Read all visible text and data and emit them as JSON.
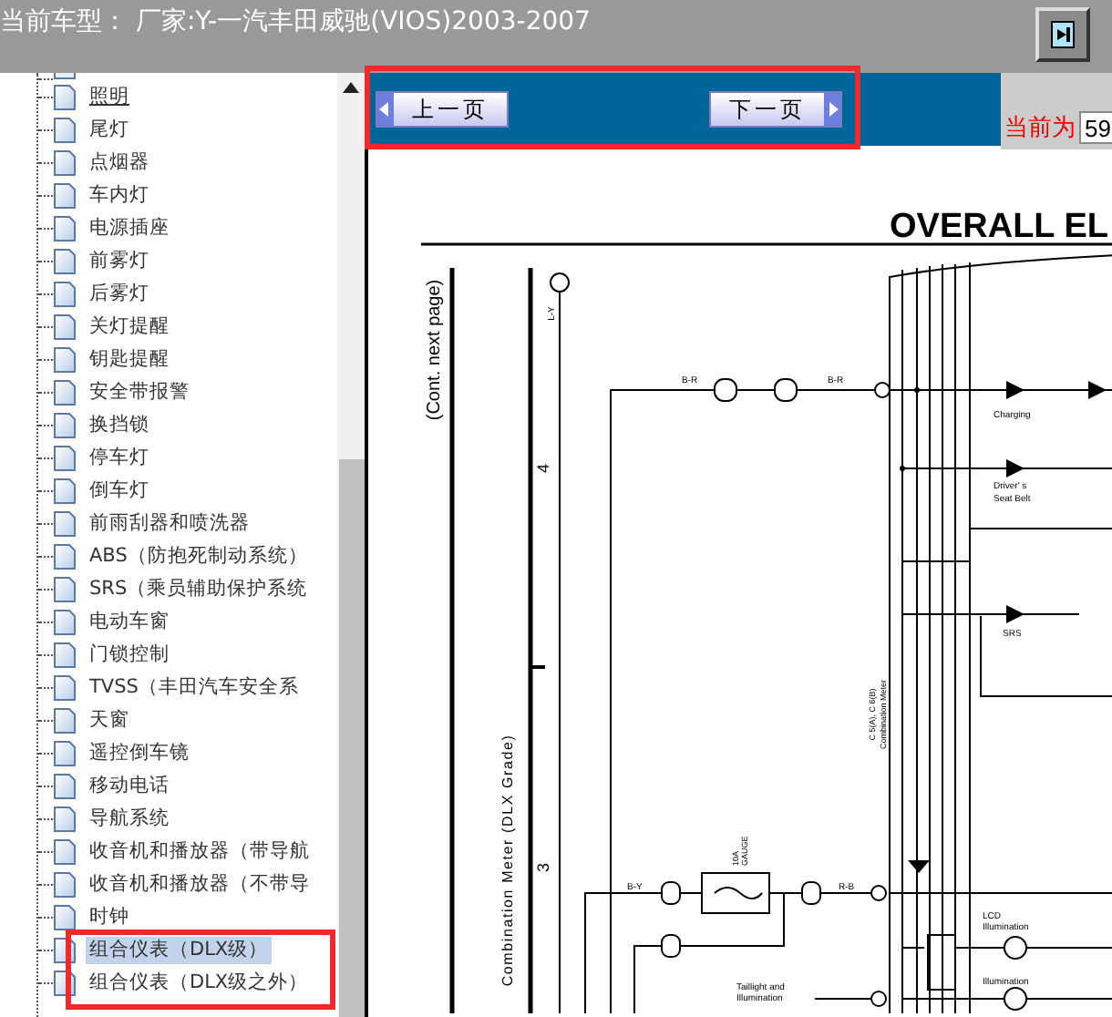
{
  "header": {
    "title": "当前车型： 厂家:Y-一汽丰田威驰(VIOS)2003-2007"
  },
  "tree": {
    "items": [
      {
        "label": "照明",
        "selected": false,
        "hovered": true
      },
      {
        "label": "尾灯",
        "selected": false,
        "hovered": false
      },
      {
        "label": "点烟器",
        "selected": false,
        "hovered": false
      },
      {
        "label": "车内灯",
        "selected": false,
        "hovered": false
      },
      {
        "label": "电源插座",
        "selected": false,
        "hovered": false
      },
      {
        "label": "前雾灯",
        "selected": false,
        "hovered": false
      },
      {
        "label": "后雾灯",
        "selected": false,
        "hovered": false
      },
      {
        "label": "关灯提醒",
        "selected": false,
        "hovered": false
      },
      {
        "label": "钥匙提醒",
        "selected": false,
        "hovered": false
      },
      {
        "label": "安全带报警",
        "selected": false,
        "hovered": false
      },
      {
        "label": "换挡锁",
        "selected": false,
        "hovered": false
      },
      {
        "label": "停车灯",
        "selected": false,
        "hovered": false
      },
      {
        "label": "倒车灯",
        "selected": false,
        "hovered": false
      },
      {
        "label": "前雨刮器和喷洗器",
        "selected": false,
        "hovered": false
      },
      {
        "label": "ABS（防抱死制动系统）",
        "selected": false,
        "hovered": false
      },
      {
        "label": "SRS（乘员辅助保护系统",
        "selected": false,
        "hovered": false
      },
      {
        "label": "电动车窗",
        "selected": false,
        "hovered": false
      },
      {
        "label": "门锁控制",
        "selected": false,
        "hovered": false
      },
      {
        "label": "TVSS（丰田汽车安全系",
        "selected": false,
        "hovered": false
      },
      {
        "label": "天窗",
        "selected": false,
        "hovered": false
      },
      {
        "label": "遥控倒车镜",
        "selected": false,
        "hovered": false
      },
      {
        "label": "移动电话",
        "selected": false,
        "hovered": false
      },
      {
        "label": "导航系统",
        "selected": false,
        "hovered": false
      },
      {
        "label": "收音机和播放器（带导航",
        "selected": false,
        "hovered": false
      },
      {
        "label": "收音机和播放器（不带导",
        "selected": false,
        "hovered": false
      },
      {
        "label": "时钟",
        "selected": false,
        "hovered": false
      },
      {
        "label": "组合仪表（DLX级）",
        "selected": true,
        "hovered": false
      },
      {
        "label": "组合仪表（DLX级之外）",
        "selected": false,
        "hovered": false
      }
    ]
  },
  "toolbar": {
    "prev_button": "上一页",
    "next_button": "下一页",
    "page_label": "当前为",
    "page_value": "59"
  },
  "diagram": {
    "title": "OVERALL EL",
    "side_note": "(Cont.  next page)",
    "section_title": "Combination Meter (DLX Grade)",
    "grid_numbers": [
      "4",
      "3"
    ],
    "labels": [
      "L-Y",
      "B-R",
      "B-R",
      "Charging",
      "Driver' s",
      "Seat Belt",
      "SRS",
      "C 5(A), C 6(B)",
      "Combination Meter",
      "10A",
      "GAUGE",
      "B-Y",
      "R-B",
      "LCD",
      "Illumination",
      "Illumination",
      "Taillight and",
      "Illumination"
    ]
  }
}
